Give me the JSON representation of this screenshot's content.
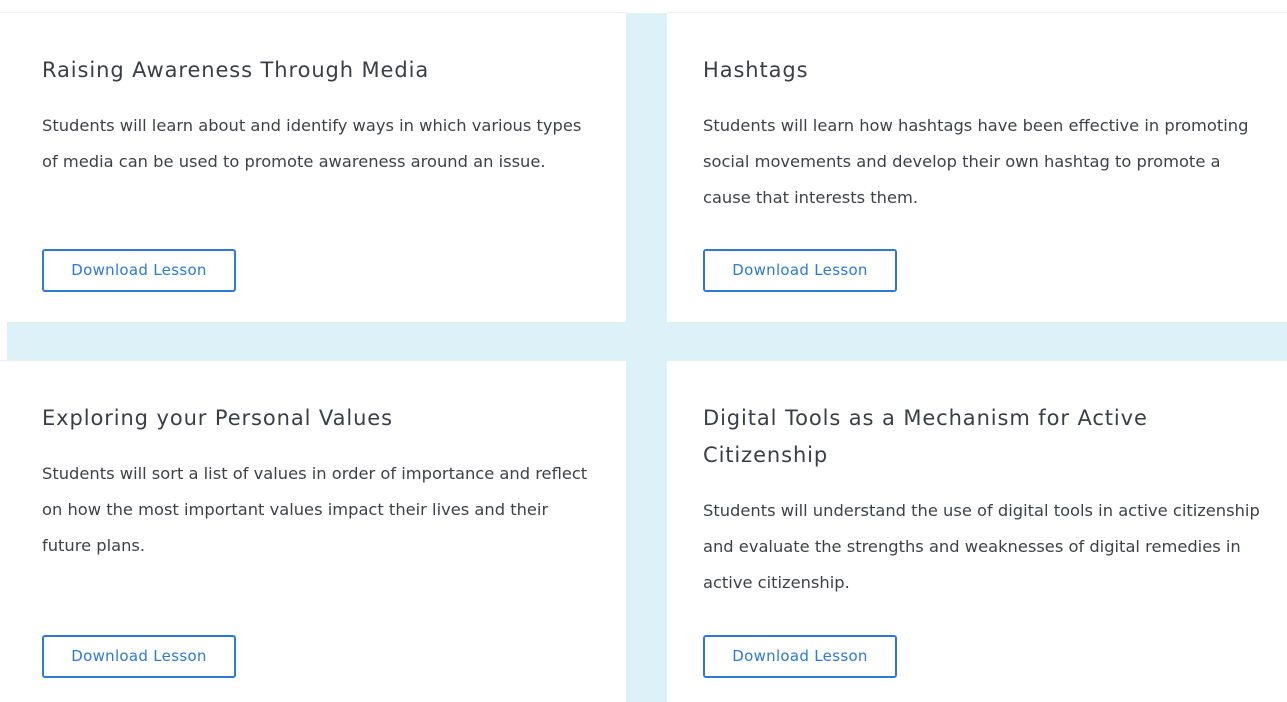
{
  "lessons": [
    {
      "title": "Raising Awareness Through Media",
      "description": "Students will learn about and identify ways in which various types of media can be used to promote awareness around an issue.",
      "button_label": "Download Lesson"
    },
    {
      "title": "Hashtags",
      "description": "Students will learn how hashtags have been effective in promoting social movements and develop their own hashtag to promote a cause that interests them.",
      "button_label": "Download Lesson"
    },
    {
      "title": "Exploring your Personal Values",
      "description": "Students will sort a list of values in order of importance and reflect on how the most important values impact their lives and their future plans.",
      "button_label": "Download Lesson"
    },
    {
      "title": "Digital Tools as a Mechanism for Active Citizenship",
      "description": "Students will understand the use of digital tools in active citizenship and evaluate the strengths and weaknesses of digital remedies in active citizenship.",
      "button_label": "Download Lesson"
    }
  ],
  "colors": {
    "accent": "#2c79d6",
    "band": "#dcf1f8",
    "text": "#3b3f45"
  }
}
